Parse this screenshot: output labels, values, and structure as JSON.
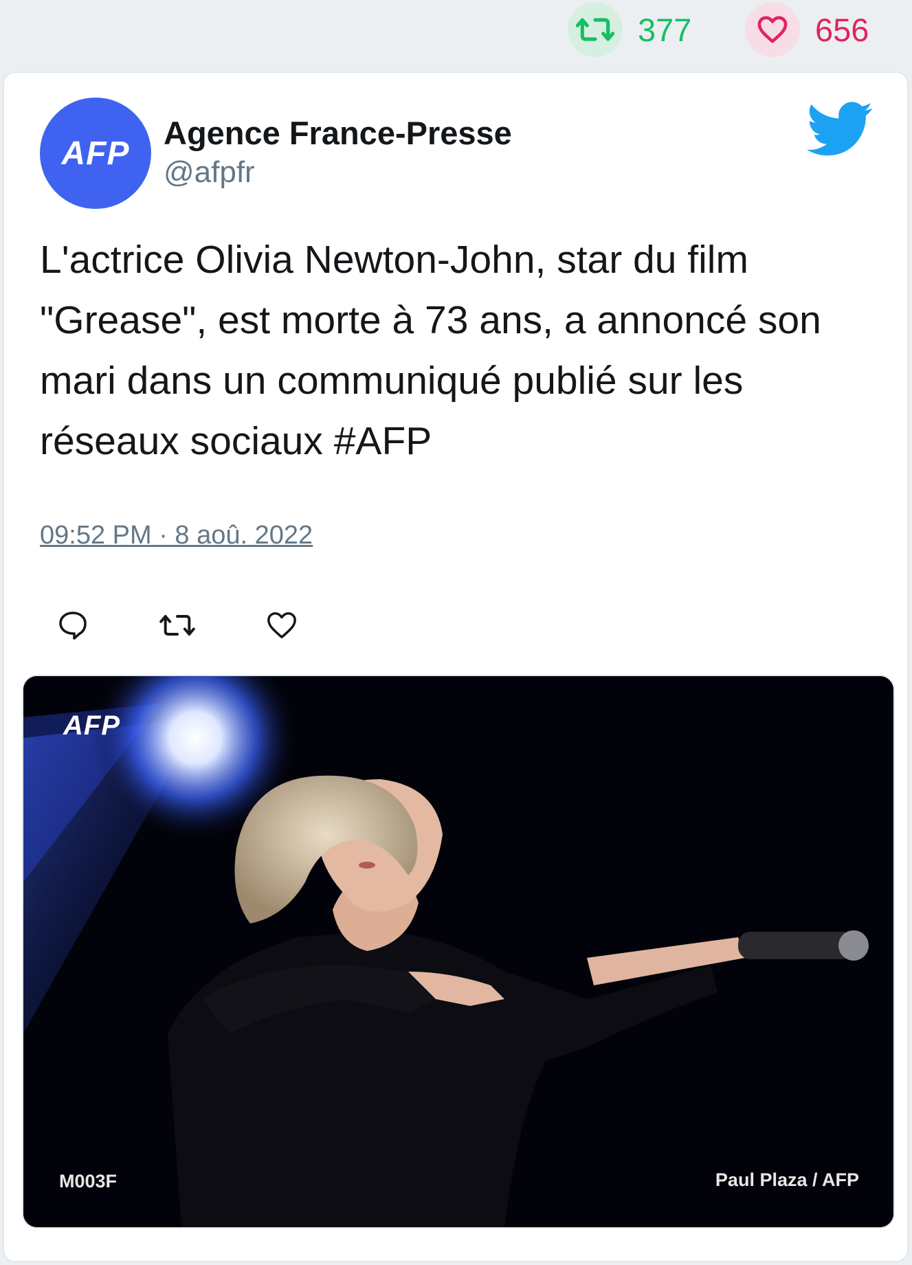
{
  "header_stats": {
    "retweets": "377",
    "likes": "656",
    "retweet_color": "#17bf63",
    "like_color": "#e0245e",
    "retweet_icon": "retweet-icon",
    "like_icon": "heart-icon"
  },
  "tweet": {
    "author_name": "Agence France-Presse",
    "author_handle": "@afpfr",
    "avatar_text": "AFP",
    "avatar_color": "#3f63f0",
    "platform_icon": "twitter-bird-icon",
    "text": "L'actrice Olivia Newton-John, star du film \"Grease\", est morte à 73 ans, a annoncé son mari dans un communiqué publié sur les réseaux sociaux #AFP",
    "timestamp": "09:52 PM · 8 aoû. 2022",
    "actions": [
      {
        "name": "reply",
        "icon": "reply-icon"
      },
      {
        "name": "retweet",
        "icon": "retweet-icon"
      },
      {
        "name": "like",
        "icon": "heart-icon"
      }
    ]
  },
  "media": {
    "brand_text": "AFP",
    "photo_code": "M003F",
    "photo_credit": "Paul Plaza / AFP"
  }
}
